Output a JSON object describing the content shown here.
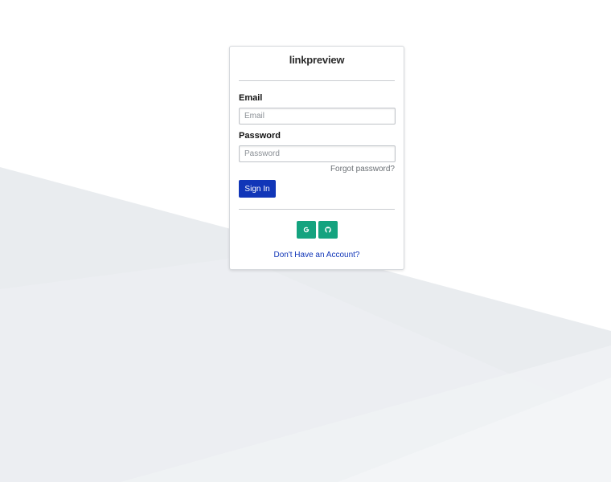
{
  "brand": {
    "logo_text": "linkpreview"
  },
  "login_form": {
    "email_label": "Email",
    "email_placeholder": "Email",
    "email_value": "",
    "password_label": "Password",
    "password_placeholder": "Password",
    "password_value": "",
    "forgot_password": "Forgot password?",
    "sign_in_label": "Sign In"
  },
  "social_login": {
    "buttons": [
      {
        "provider": "google",
        "icon": "google-icon"
      },
      {
        "provider": "github",
        "icon": "github-icon"
      }
    ],
    "button_color": "#14a37f"
  },
  "footer": {
    "account_link": "Don't Have an Account?"
  },
  "colors": {
    "primary": "#1136b8",
    "social": "#14a37f",
    "background_shape": "#e8ecef"
  }
}
